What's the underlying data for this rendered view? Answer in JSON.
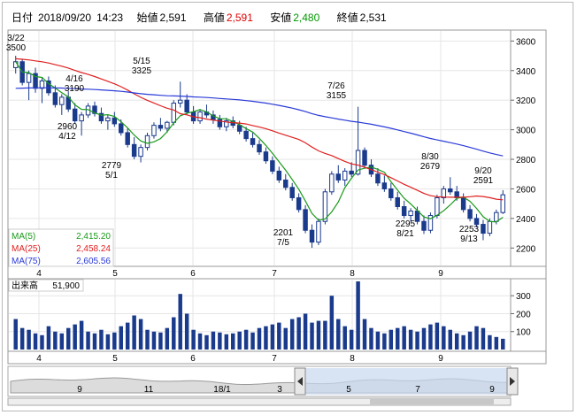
{
  "header": {
    "date_label": "日付",
    "date": "2018/09/20",
    "time": "14:23",
    "open_label": "始値",
    "open": "2,591",
    "high_label": "高値",
    "high": "2,591",
    "low_label": "安値",
    "low": "2,480",
    "close_label": "終値",
    "close": "2,531"
  },
  "colors": {
    "candle": "#1a3a8c",
    "ma5": "#1a9a1a",
    "ma25": "#e02020",
    "ma75": "#2a3ad8",
    "volume": "#1a3a8c",
    "grid": "#e6e6e6",
    "nav_fill": "#c8d8f0"
  },
  "legend": [
    {
      "label": "MA(5)",
      "value": "2,415.20",
      "color": "#1a9a1a"
    },
    {
      "label": "MA(25)",
      "value": "2,458.24",
      "color": "#e02020"
    },
    {
      "label": "MA(75)",
      "value": "2,605.56",
      "color": "#2a3ad8"
    }
  ],
  "volume_label": "出来高",
  "volume_value": "51,900",
  "chart_data": {
    "type": "candlestick",
    "price_axis": {
      "ticks": [
        "3600",
        "3400",
        "3200",
        "3000",
        "2800",
        "2600",
        "2400",
        "2200"
      ],
      "ylim": [
        2100,
        3650
      ]
    },
    "volume_axis": {
      "ticks": [
        "300",
        "200",
        "100"
      ],
      "ylim": [
        0,
        380
      ]
    },
    "x_ticks": [
      "4",
      "5",
      "6",
      "7",
      "8",
      "9"
    ],
    "annotations": [
      {
        "date": "3/22",
        "price": "3500"
      },
      {
        "date": "4/16",
        "price": "3190"
      },
      {
        "date": "4/12",
        "price": "2960"
      },
      {
        "date": "5/15",
        "price": "3325"
      },
      {
        "date": "5/1",
        "price": "2779"
      },
      {
        "date": "7/26",
        "price": "3155"
      },
      {
        "date": "7/5",
        "price": "2201"
      },
      {
        "date": "8/30",
        "price": "2679"
      },
      {
        "date": "8/21",
        "price": "2295"
      },
      {
        "date": "9/20",
        "price": "2591"
      },
      {
        "date": "9/13",
        "price": "2253"
      }
    ],
    "candles": [
      [
        3420,
        3500,
        3380,
        3460
      ],
      [
        3460,
        3480,
        3300,
        3320
      ],
      [
        3320,
        3400,
        3200,
        3380
      ],
      [
        3380,
        3420,
        3250,
        3280
      ],
      [
        3280,
        3350,
        3180,
        3330
      ],
      [
        3330,
        3360,
        3230,
        3250
      ],
      [
        3250,
        3300,
        3150,
        3170
      ],
      [
        3170,
        3240,
        3100,
        3220
      ],
      [
        3220,
        3260,
        3120,
        3140
      ],
      [
        3140,
        3180,
        3040,
        3060
      ],
      [
        3060,
        3120,
        2960,
        3100
      ],
      [
        3100,
        3180,
        3080,
        3160
      ],
      [
        3160,
        3190,
        3090,
        3110
      ],
      [
        3110,
        3150,
        3040,
        3060
      ],
      [
        3060,
        3100,
        3000,
        3080
      ],
      [
        3080,
        3120,
        3020,
        3040
      ],
      [
        3040,
        3070,
        2960,
        2980
      ],
      [
        2980,
        3010,
        2880,
        2900
      ],
      [
        2900,
        2950,
        2800,
        2820
      ],
      [
        2820,
        2900,
        2779,
        2880
      ],
      [
        2880,
        2980,
        2860,
        2960
      ],
      [
        2960,
        3050,
        2940,
        3030
      ],
      [
        3030,
        3080,
        2990,
        3010
      ],
      [
        3010,
        3060,
        2980,
        3050
      ],
      [
        3050,
        3200,
        3030,
        3180
      ],
      [
        3180,
        3325,
        3150,
        3200
      ],
      [
        3200,
        3240,
        3100,
        3120
      ],
      [
        3120,
        3160,
        3040,
        3060
      ],
      [
        3060,
        3140,
        3040,
        3120
      ],
      [
        3120,
        3170,
        3080,
        3100
      ],
      [
        3100,
        3130,
        3040,
        3070
      ],
      [
        3070,
        3100,
        3000,
        3020
      ],
      [
        3020,
        3080,
        2990,
        3060
      ],
      [
        3060,
        3090,
        3010,
        3030
      ],
      [
        3030,
        3060,
        2970,
        2990
      ],
      [
        2990,
        3020,
        2920,
        2940
      ],
      [
        2940,
        2980,
        2880,
        2900
      ],
      [
        2900,
        2930,
        2830,
        2850
      ],
      [
        2850,
        2880,
        2770,
        2790
      ],
      [
        2790,
        2820,
        2700,
        2720
      ],
      [
        2720,
        2750,
        2640,
        2660
      ],
      [
        2660,
        2700,
        2590,
        2610
      ],
      [
        2610,
        2640,
        2520,
        2540
      ],
      [
        2540,
        2570,
        2440,
        2460
      ],
      [
        2460,
        2490,
        2300,
        2320
      ],
      [
        2320,
        2360,
        2201,
        2240
      ],
      [
        2240,
        2400,
        2220,
        2380
      ],
      [
        2380,
        2600,
        2360,
        2580
      ],
      [
        2580,
        2720,
        2560,
        2700
      ],
      [
        2700,
        2760,
        2640,
        2660
      ],
      [
        2660,
        2740,
        2620,
        2720
      ],
      [
        2720,
        2780,
        2680,
        2700
      ],
      [
        2700,
        3155,
        2690,
        2860
      ],
      [
        2860,
        2880,
        2740,
        2760
      ],
      [
        2760,
        2800,
        2680,
        2700
      ],
      [
        2700,
        2740,
        2620,
        2640
      ],
      [
        2640,
        2690,
        2580,
        2600
      ],
      [
        2600,
        2640,
        2520,
        2540
      ],
      [
        2540,
        2580,
        2460,
        2480
      ],
      [
        2480,
        2520,
        2400,
        2420
      ],
      [
        2420,
        2470,
        2380,
        2450
      ],
      [
        2450,
        2480,
        2360,
        2380
      ],
      [
        2380,
        2420,
        2295,
        2320
      ],
      [
        2320,
        2440,
        2300,
        2420
      ],
      [
        2420,
        2560,
        2400,
        2540
      ],
      [
        2540,
        2620,
        2500,
        2600
      ],
      [
        2600,
        2679,
        2560,
        2580
      ],
      [
        2580,
        2620,
        2520,
        2540
      ],
      [
        2540,
        2570,
        2440,
        2460
      ],
      [
        2460,
        2490,
        2380,
        2400
      ],
      [
        2400,
        2430,
        2340,
        2360
      ],
      [
        2360,
        2390,
        2253,
        2300
      ],
      [
        2300,
        2400,
        2280,
        2380
      ],
      [
        2380,
        2460,
        2360,
        2440
      ],
      [
        2440,
        2591,
        2430,
        2560
      ]
    ],
    "volumes": [
      170,
      120,
      110,
      90,
      80,
      130,
      100,
      90,
      120,
      140,
      160,
      100,
      90,
      110,
      85,
      95,
      130,
      150,
      190,
      170,
      110,
      100,
      95,
      120,
      180,
      310,
      200,
      110,
      90,
      80,
      100,
      95,
      85,
      90,
      100,
      110,
      95,
      120,
      130,
      140,
      150,
      120,
      170,
      180,
      200,
      150,
      160,
      160,
      300,
      170,
      130,
      110,
      380,
      170,
      120,
      100,
      90,
      110,
      120,
      130,
      110,
      100,
      120,
      140,
      150,
      130,
      110,
      90,
      80,
      100,
      130,
      120,
      80,
      70,
      60
    ],
    "ma5_shape": "green",
    "ma25_shape": "red",
    "ma75_shape": "blue"
  },
  "navigator": {
    "ticks": [
      "9",
      "11",
      "18/1",
      "3",
      "5",
      "7",
      "9"
    ],
    "range_start": "4",
    "range_end": "9/20"
  }
}
